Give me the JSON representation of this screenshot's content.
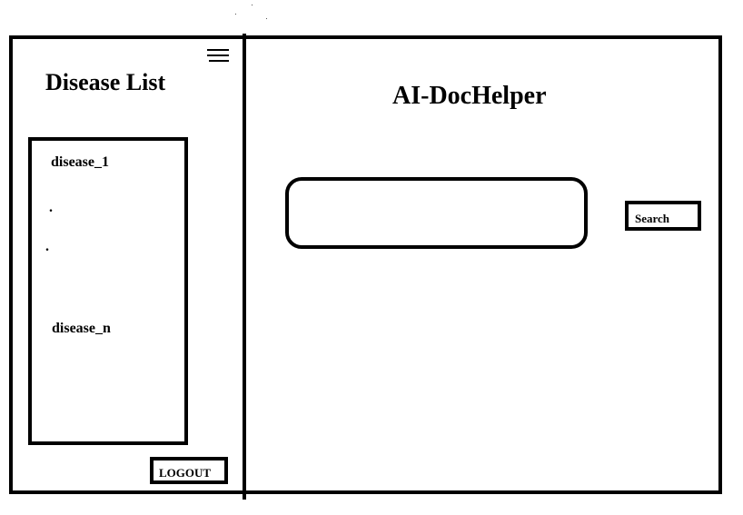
{
  "sidebar": {
    "title": "Disease List",
    "menu_icon": "hamburger-menu-icon",
    "diseases": {
      "first": "disease_1",
      "ellipsis_1": ".",
      "ellipsis_2": ".",
      "last": "disease_n"
    },
    "logout_label": "LOGOUT"
  },
  "main": {
    "title": "AI-DocHelper",
    "search": {
      "value": "",
      "placeholder": "",
      "button_label": "Search"
    }
  },
  "colors": {
    "stroke": "#000000",
    "background": "#ffffff"
  }
}
